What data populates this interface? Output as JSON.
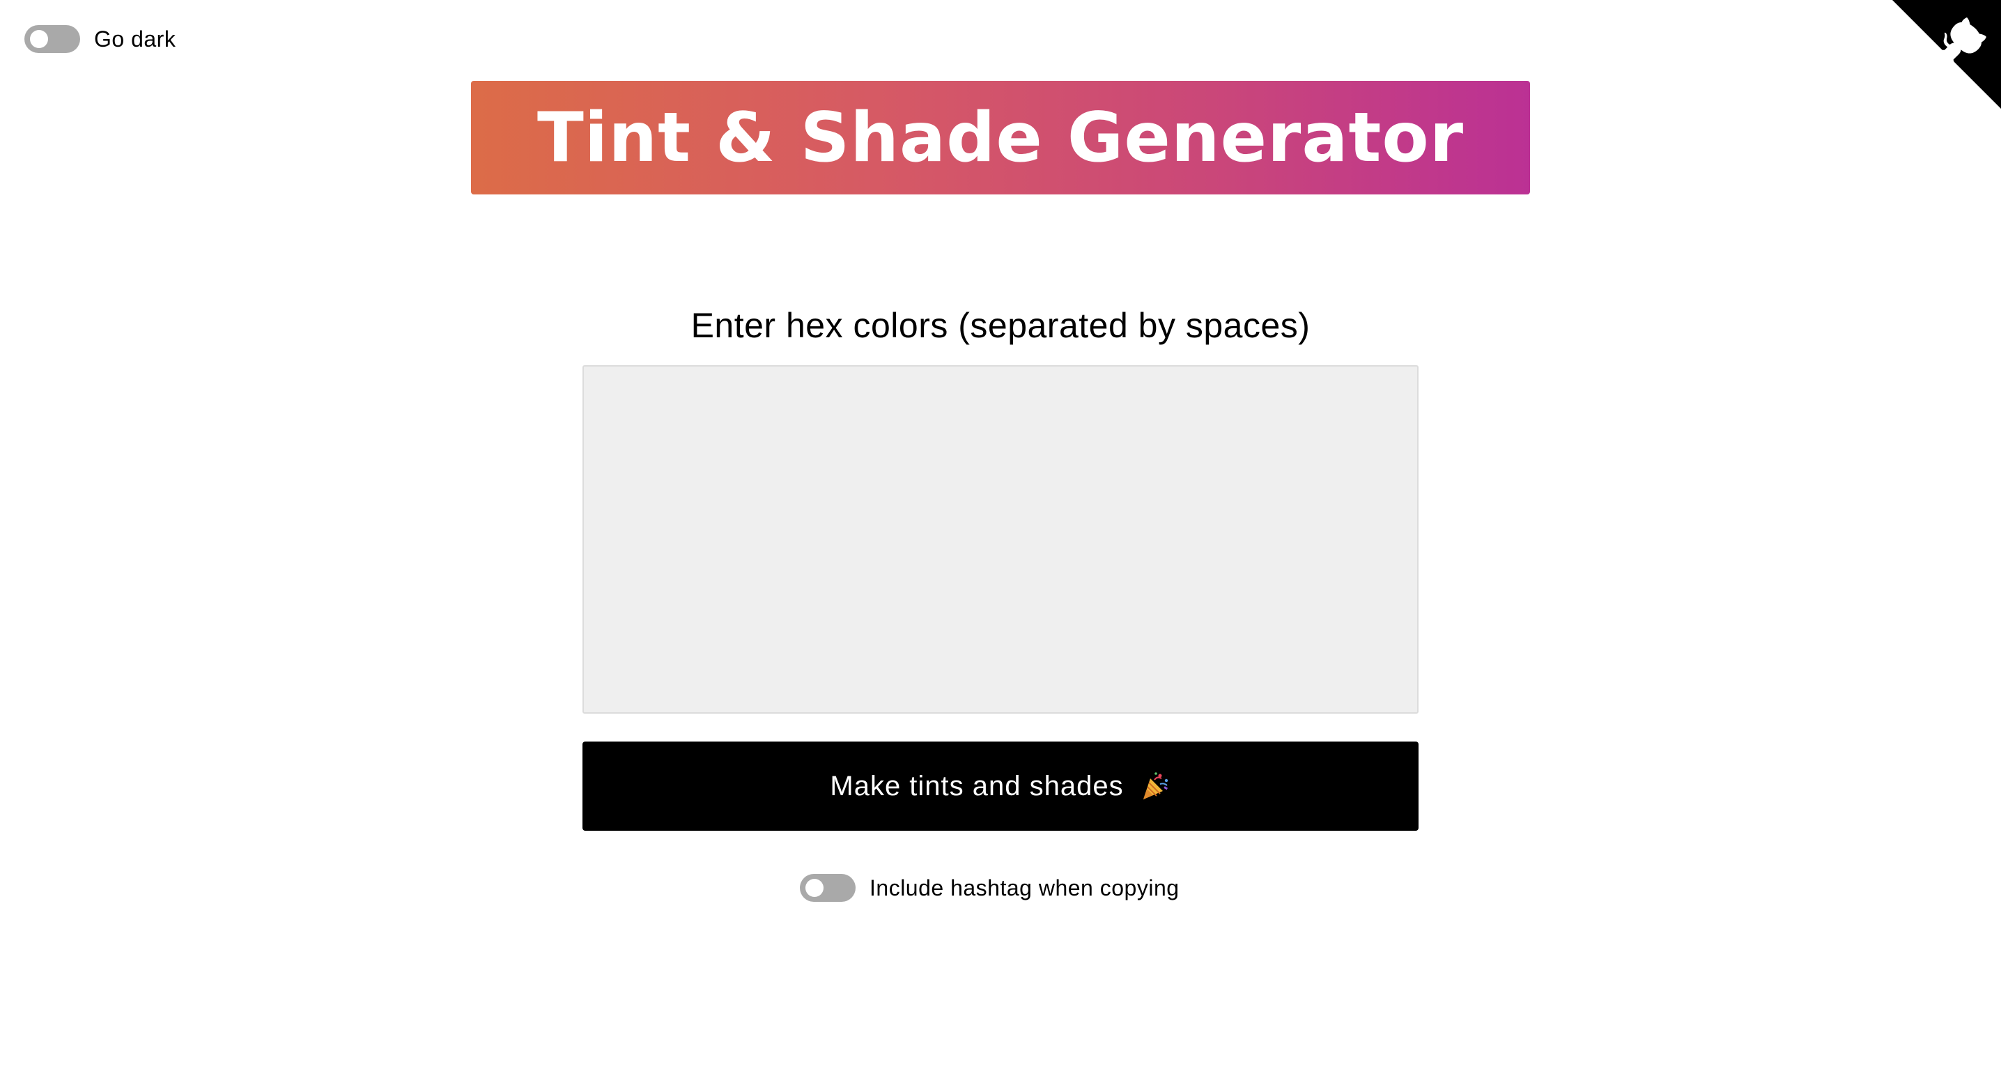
{
  "dark_toggle": {
    "label": "Go dark",
    "checked": false
  },
  "header": {
    "title": "Tint & Shade Generator",
    "gradient_start": "#dc6c48",
    "gradient_end": "#bb3194"
  },
  "input": {
    "label": "Enter hex colors (separated by spaces)",
    "value": "",
    "placeholder": ""
  },
  "generate_button": {
    "label": "Make tints and shades",
    "icon": "party-popper-icon"
  },
  "hashtag_toggle": {
    "label": "Include hashtag when copying",
    "checked": false
  },
  "github_corner": {
    "icon": "github-octocat-icon"
  },
  "colors": {
    "button_bg": "#000000",
    "textarea_bg": "#efefef",
    "toggle_off": "#a9a9a9"
  }
}
